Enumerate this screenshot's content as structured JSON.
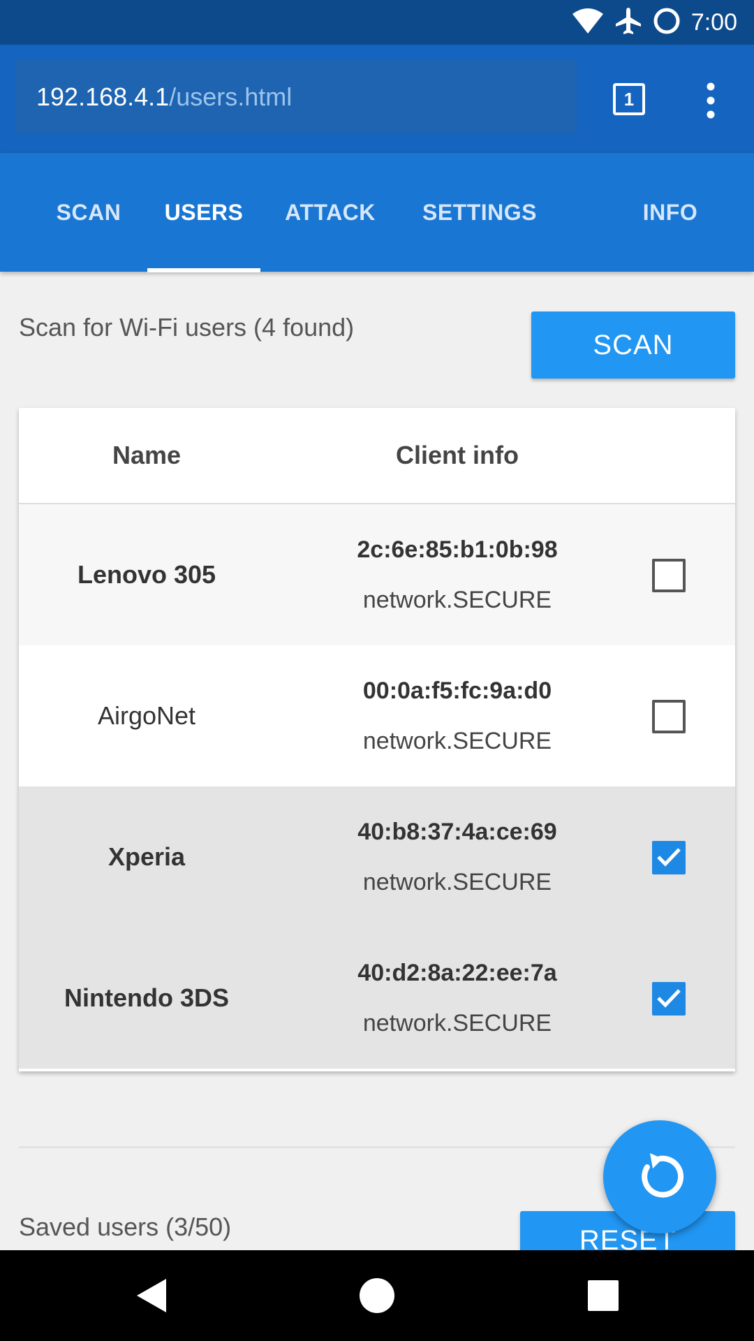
{
  "status_bar": {
    "time": "7:00",
    "icons": [
      "wifi-icon",
      "airplane-icon",
      "sync-circle-icon"
    ]
  },
  "browser": {
    "url_host": "192.168.4.1",
    "url_path": "/users.html",
    "tab_count": "1",
    "menu_icon": "overflow-menu-icon"
  },
  "nav": {
    "tabs": [
      {
        "label": "SCAN",
        "active": false
      },
      {
        "label": "USERS",
        "active": true
      },
      {
        "label": "ATTACK",
        "active": false
      },
      {
        "label": "SETTINGS",
        "active": false
      },
      {
        "label": "INFO",
        "active": false
      }
    ]
  },
  "scan": {
    "description": "Scan for Wi-Fi users (4 found)",
    "button_label": "SCAN"
  },
  "table": {
    "headers": {
      "name": "Name",
      "client_info": "Client info"
    },
    "rows": [
      {
        "name": "Lenovo 305",
        "mac": "2c:6e:85:b1:0b:98",
        "network": "network.SECURE",
        "selected": false,
        "bold": true
      },
      {
        "name": "AirgoNet",
        "mac": "00:0a:f5:fc:9a:d0",
        "network": "network.SECURE",
        "selected": false,
        "bold": false
      },
      {
        "name": "Xperia",
        "mac": "40:b8:37:4a:ce:69",
        "network": "network.SECURE",
        "selected": true,
        "bold": true
      },
      {
        "name": "Nintendo 3DS",
        "mac": "40:d2:8a:22:ee:7a",
        "network": "network.SECURE",
        "selected": true,
        "bold": true
      }
    ]
  },
  "saved": {
    "description": "Saved users (3/50)",
    "reset_label": "RESET"
  },
  "fab_icon": "refresh-icon",
  "system_nav": {
    "back": "back-icon",
    "home": "home-icon",
    "recents": "recents-icon"
  },
  "colors": {
    "primary": "#1976d2",
    "accent": "#2196f3",
    "status_bar": "#0d4a8c"
  }
}
